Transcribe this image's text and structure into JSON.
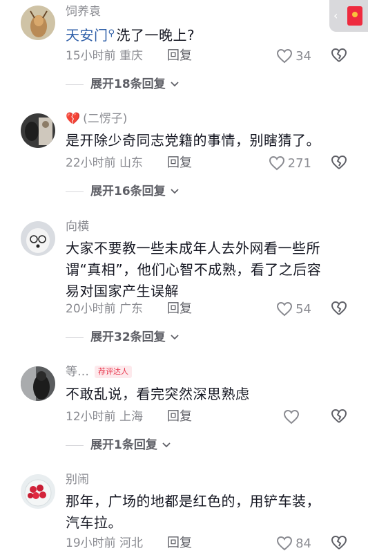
{
  "top_pill": {
    "chevron": "‹"
  },
  "comments": [
    {
      "username": "饲养袁",
      "mention": "天安门",
      "text": "洗了一晚上?",
      "time": "15小时前",
      "location": "重庆",
      "reply_label": "回复",
      "likes": "34",
      "expand_label": "展开18条回复"
    },
    {
      "username_prefix_icon": "broken-heart-icon",
      "username": "(二愣子)",
      "text": "是开除少奇同志党籍的事情，别瞎猜了。",
      "time": "22小时前",
      "location": "山东",
      "reply_label": "回复",
      "likes": "271",
      "expand_label": "展开16条回复"
    },
    {
      "username": "向横",
      "text_lines": [
        "大家不要教一些未成年人去外网看一些所",
        "谓“真相”，他们心智不成熟，看了之后容",
        "易对国家产生误解"
      ],
      "time": "20小时前",
      "location": "广东",
      "reply_label": "回复",
      "likes": "54",
      "expand_label": "展开32条回复"
    },
    {
      "username": "等…",
      "badge": "荐评达人",
      "text": "不敢乱说，看完突然深思熟虑",
      "time": "12小时前",
      "location": "上海",
      "reply_label": "回复",
      "likes": "",
      "expand_label": "展开1条回复"
    },
    {
      "username": "别闹",
      "text_lines": [
        "那年，广场的地都是红色的，用铲车装，",
        "汽车拉。"
      ],
      "time": "19小时前",
      "location": "河北",
      "reply_label": "回复",
      "likes": "84"
    }
  ],
  "colors": {
    "text": "#161823",
    "secondary": "#8a8b91",
    "mention": "#2f5fa8",
    "badge_text": "#e8374d",
    "badge_bg": "#fde9ec"
  }
}
